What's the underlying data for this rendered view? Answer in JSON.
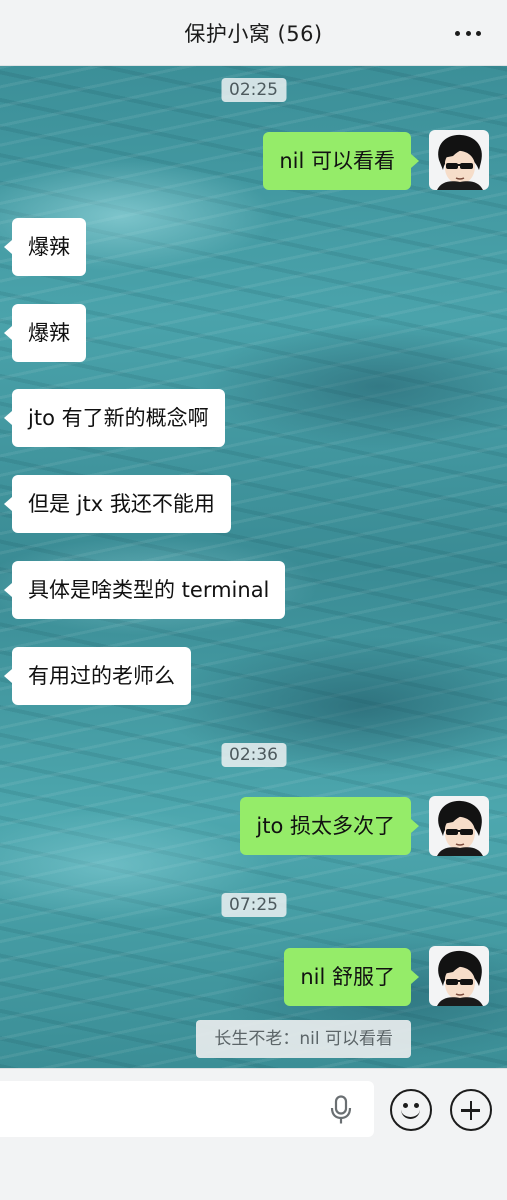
{
  "header": {
    "title": "保护小窝 (56)",
    "more_icon": "more-dots-icon"
  },
  "messages": {
    "t1": "02:25",
    "m1": "nil 可以看看",
    "m2": "爆辣",
    "m3": "爆辣",
    "m4": "jto 有了新的概念啊",
    "m5": "但是 jtx 我还不能用",
    "m6": "具体是啥类型的 terminal",
    "m7": "有用过的老师么",
    "t2": "02:36",
    "m8": "jto 损太多次了",
    "t3": "07:25",
    "m9": "nil 舒服了",
    "quote": "长生不老：nil 可以看看"
  },
  "input": {
    "mic_icon": "microphone-icon",
    "emoji_icon": "emoji-icon",
    "plus_icon": "plus-icon"
  },
  "colors": {
    "outgoing_bubble": "#95ec69",
    "incoming_bubble": "#ffffff",
    "header_bg": "#f2f3f4"
  }
}
